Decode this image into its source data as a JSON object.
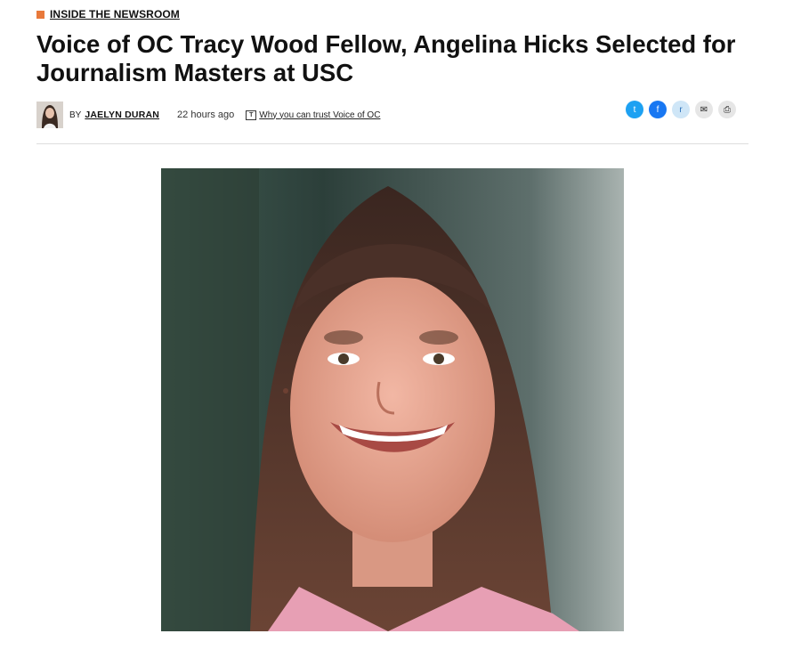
{
  "category": {
    "label": "INSIDE THE NEWSROOM",
    "accent": "#e8793b"
  },
  "article": {
    "title": "Voice of OC Tracy Wood Fellow, Angelina Hicks Selected for Journalism Masters at USC"
  },
  "byline": {
    "by": "BY",
    "author": "JAELYN DURAN",
    "time": "22 hours ago",
    "trust_icon": "T",
    "trust_link": "Why you can trust Voice of OC"
  },
  "share": {
    "buttons": [
      {
        "icon": "twitter-icon",
        "glyph": "t",
        "color": "#1da1f2"
      },
      {
        "icon": "facebook-icon",
        "glyph": "f",
        "color": "#1877f2"
      },
      {
        "icon": "reddit-icon",
        "glyph": "r",
        "color": "#cfe6f7"
      },
      {
        "icon": "email-icon",
        "glyph": "✉",
        "color": "#e6e6e6"
      },
      {
        "icon": "print-icon",
        "glyph": "⎙",
        "color": "#e6e6e6"
      }
    ]
  }
}
